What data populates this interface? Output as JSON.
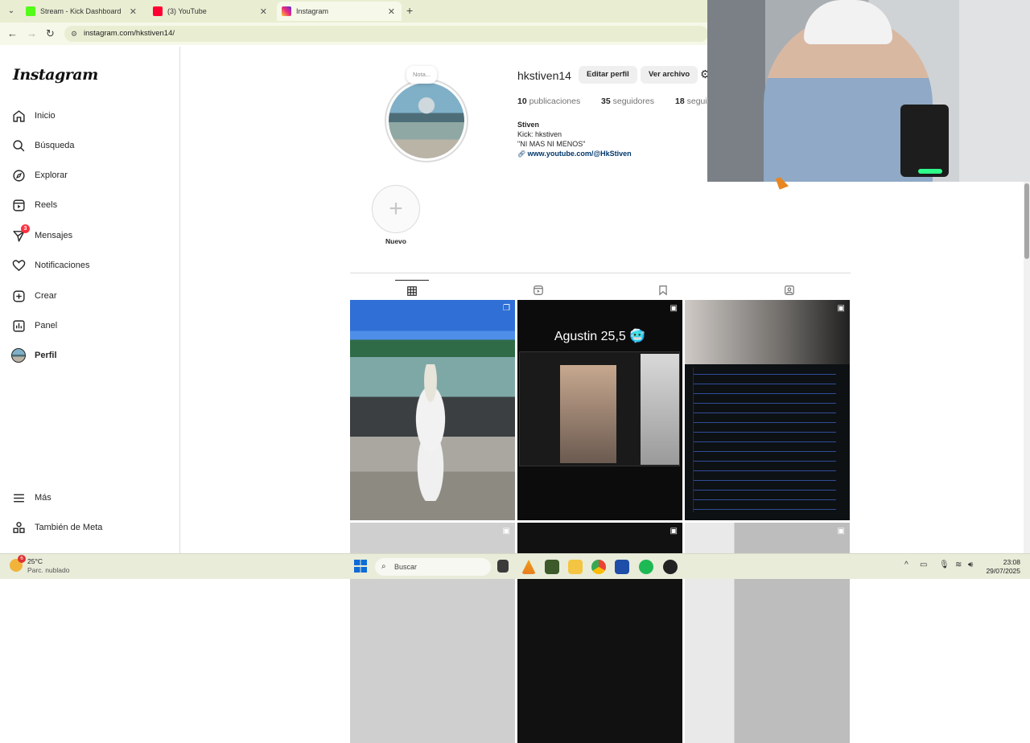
{
  "browser": {
    "tabs": [
      {
        "title": "Stream - Kick Dashboard",
        "favicon_color": "#53fc18"
      },
      {
        "title": "(3) YouTube",
        "favicon_color": "#ff0033"
      },
      {
        "title": "Instagram",
        "favicon_color": "#d62976"
      }
    ],
    "url": "instagram.com/hkstiven14/"
  },
  "instagram": {
    "logo": "Instagram",
    "nav": [
      {
        "label": "Inicio",
        "icon": "home-icon"
      },
      {
        "label": "Búsqueda",
        "icon": "search-icon"
      },
      {
        "label": "Explorar",
        "icon": "compass-icon"
      },
      {
        "label": "Reels",
        "icon": "reels-icon"
      },
      {
        "label": "Mensajes",
        "icon": "messenger-icon",
        "badge": "3"
      },
      {
        "label": "Notificaciones",
        "icon": "heart-icon"
      },
      {
        "label": "Crear",
        "icon": "plus-square-icon"
      },
      {
        "label": "Panel",
        "icon": "chart-icon"
      },
      {
        "label": "Perfil",
        "icon": "avatar-icon"
      }
    ],
    "more": "Más",
    "meta": "También de Meta"
  },
  "profile": {
    "note": "Nota...",
    "username": "hkstiven14",
    "edit_button": "Editar perfil",
    "archive_button": "Ver archivo",
    "posts_count": "10",
    "posts_label": "publicaciones",
    "followers_count": "35",
    "followers_label": "seguidores",
    "following_count": "18",
    "following_label": "segui",
    "name": "Stiven",
    "bio_line1": "Kick: hkstiven",
    "bio_line2": "\"NI MAS NI MENOS\"",
    "link": "www.youtube.com/@HkStiven",
    "highlight_label": "Nuevo"
  },
  "posts": [
    {
      "caption": ""
    },
    {
      "caption": "Agustin 25,5 🥶"
    },
    {
      "caption": ""
    }
  ],
  "taskbar": {
    "weather_badge": "6",
    "temp": "25°C",
    "condition": "Parc. nublado",
    "search": "Buscar",
    "time": "23:08",
    "date": "29/07/2025"
  }
}
